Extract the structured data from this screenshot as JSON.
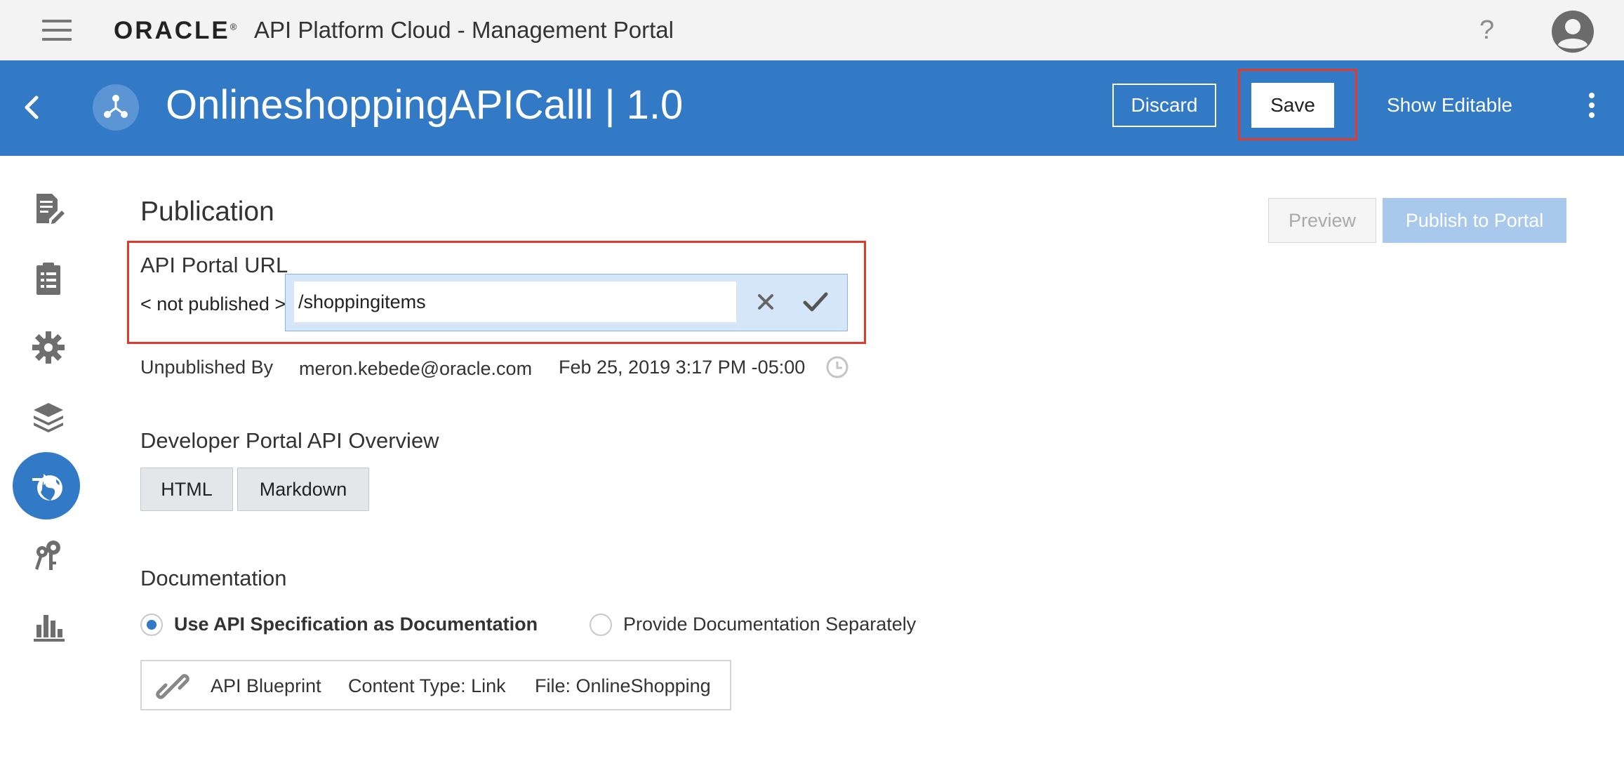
{
  "topbar": {
    "brand": "ORACLE",
    "brand_mark": "®",
    "app_title": "API Platform Cloud - Management Portal",
    "help_label": "?"
  },
  "header": {
    "api_title": "OnlineshoppingAPICalll | 1.0",
    "discard_label": "Discard",
    "save_label": "Save",
    "show_editable_label": "Show Editable"
  },
  "sidebar": {
    "items": [
      {
        "icon": "edit-document-icon"
      },
      {
        "icon": "clipboard-icon"
      },
      {
        "icon": "gear-icon"
      },
      {
        "icon": "layers-icon"
      },
      {
        "icon": "globe-publish-icon",
        "active": true
      },
      {
        "icon": "keys-icon"
      },
      {
        "icon": "bar-chart-icon"
      }
    ]
  },
  "publication": {
    "title": "Publication",
    "preview_label": "Preview",
    "publish_label": "Publish to Portal",
    "url_label": "API Portal URL",
    "url_prefix": "< not published >",
    "url_value": "/shoppingitems",
    "unpublished_by_label": "Unpublished By",
    "unpublished_by_user": "meron.kebede@oracle.com",
    "unpublished_date": "Feb 25, 2019 3:17 PM -05:00"
  },
  "overview": {
    "label": "Developer Portal API Overview",
    "html_label": "HTML",
    "markdown_label": "Markdown"
  },
  "documentation": {
    "label": "Documentation",
    "option_spec": "Use API Specification as Documentation",
    "option_separate": "Provide Documentation Separately",
    "selected": "spec",
    "blueprint_name": "API Blueprint",
    "content_type": "Content Type: Link",
    "file": "File: OnlineShopping"
  },
  "colors": {
    "header_blue": "#3279c6",
    "highlight_red": "#e03a2b",
    "publish_disabled": "#a8c8ec"
  }
}
